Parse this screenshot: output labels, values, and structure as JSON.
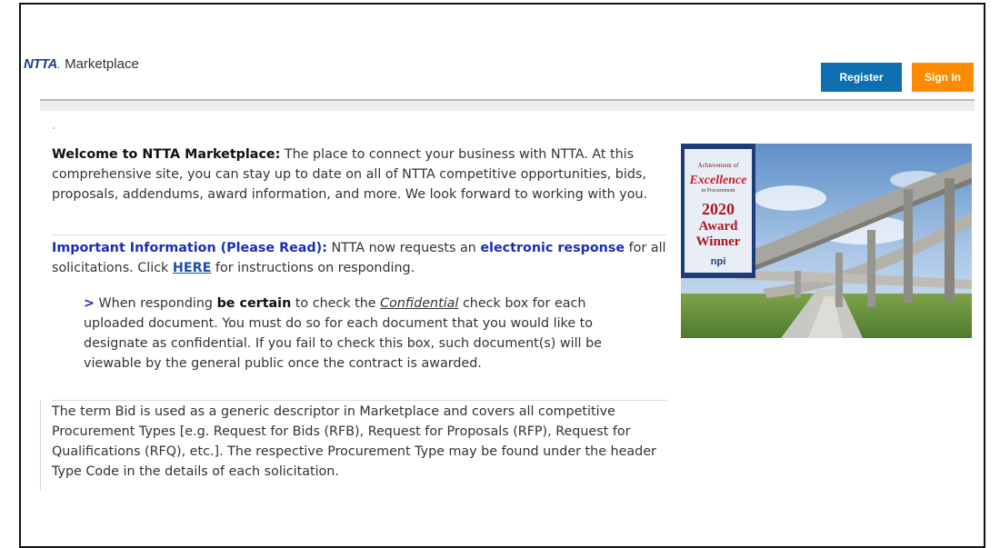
{
  "header": {
    "logo_brand": "NTTA",
    "logo_text": "Marketplace",
    "register_label": "Register",
    "signin_label": "Sign In"
  },
  "welcome": {
    "lead": "Welcome to NTTA Marketplace:",
    "body": " The place to connect your business with NTTA. At this comprehensive site, you can stay up to date on all of NTTA competitive opportunities, bids, proposals, addendums, award information, and more. We look forward to working with you."
  },
  "important": {
    "lead": "Important Information (Please Read):",
    "text1": " NTTA now requests an ",
    "emphasis": "electronic response",
    "text2": " for all solicitations. Click ",
    "link": "HERE",
    "text3": " for instructions on responding."
  },
  "note": {
    "arrow": ">",
    "text1": " When responding ",
    "bold": "be certain",
    "text2": " to check the ",
    "confidential": "Confidential",
    "text3": " check box for each uploaded document. You must do so for each document that you would like to designate as confidential. If you fail to check this box, such document(s) will be viewable by the general public once the contract is awarded."
  },
  "bid_info": "The term Bid is used as a generic descriptor in Marketplace and covers all competitive Procurement Types [e.g. Request for Bids (RFB), Request for Proposals (RFP), Request for Qualifications (RFQ), etc.]. The respective Procurement Type may be found under the header Type Code in the details of each solicitation.",
  "award_badge": {
    "line1": "Achievement of",
    "line2": "Excellence",
    "line3": "in Procurement",
    "year": "2020",
    "award": "Award",
    "winner": "Winner",
    "org": "npi"
  },
  "colors": {
    "register": "#0d6eb0",
    "signin": "#ff8a00",
    "accent_blue": "#1a2fb8",
    "brand_navy": "#1b3f8b"
  },
  "icons": {
    "award_image": "highway-interchange-photo"
  }
}
